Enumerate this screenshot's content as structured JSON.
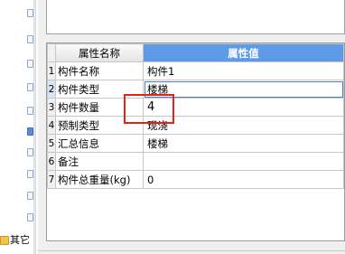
{
  "sidebar": {
    "other_label": "其它"
  },
  "property_grid": {
    "header_name": "属性名称",
    "header_value": "属性值",
    "rows": [
      {
        "index": "1",
        "name": "构件名称",
        "value": "构件1"
      },
      {
        "index": "2",
        "name": "构件类型",
        "value": "楼梯"
      },
      {
        "index": "3",
        "name": "构件数量",
        "value": "4"
      },
      {
        "index": "4",
        "name": "预制类型",
        "value": "现浇"
      },
      {
        "index": "5",
        "name": "汇总信息",
        "value": "楼梯"
      },
      {
        "index": "6",
        "name": "备注",
        "value": ""
      },
      {
        "index": "7",
        "name": "构件总重量(kg)",
        "value": "0"
      }
    ]
  },
  "colors": {
    "header_accent": "#5f9ae6",
    "highlight": "#e2231a"
  }
}
